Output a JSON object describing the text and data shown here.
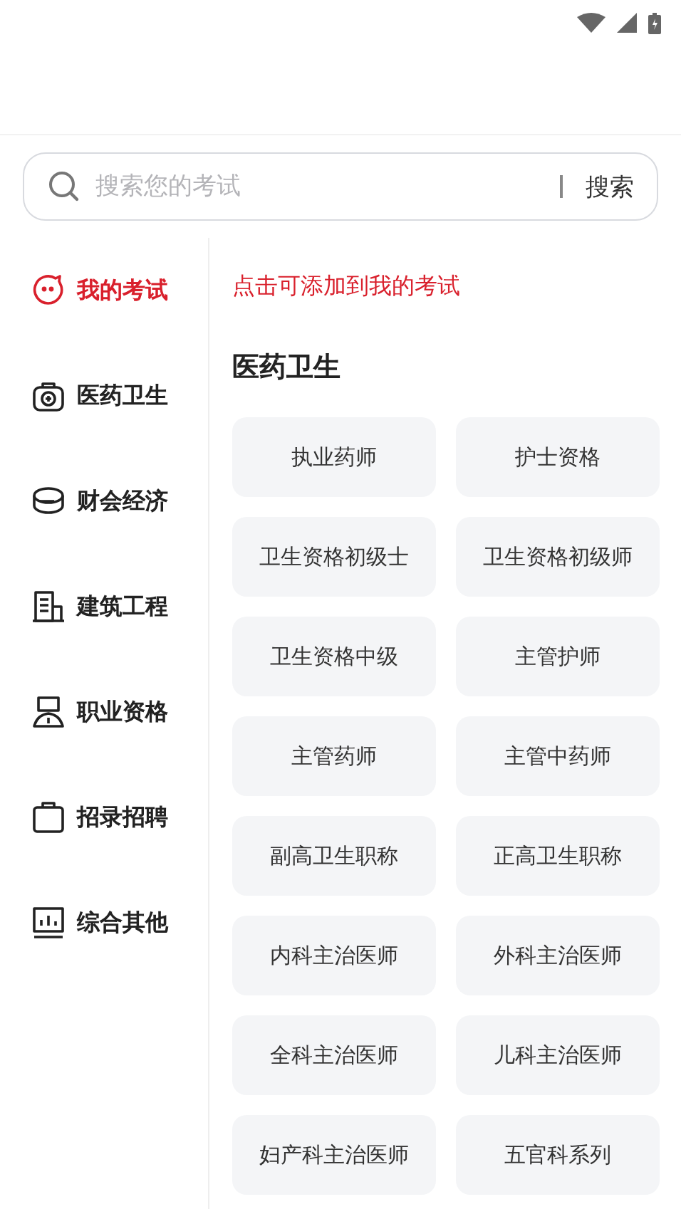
{
  "search": {
    "placeholder": "搜索您的考试",
    "button": "搜索"
  },
  "sidebar": {
    "items": [
      {
        "label": "我的考试",
        "selected": true
      },
      {
        "label": "医药卫生",
        "selected": false
      },
      {
        "label": "财会经济",
        "selected": false
      },
      {
        "label": "建筑工程",
        "selected": false
      },
      {
        "label": "职业资格",
        "selected": false
      },
      {
        "label": "招录招聘",
        "selected": false
      },
      {
        "label": "综合其他",
        "selected": false
      }
    ]
  },
  "hint": "点击可添加到我的考试",
  "section": {
    "title": "医药卫生",
    "exams": [
      "执业药师",
      "护士资格",
      "卫生资格初级士",
      "卫生资格初级师",
      "卫生资格中级",
      "主管护师",
      "主管药师",
      "主管中药师",
      "副高卫生职称",
      "正高卫生职称",
      "内科主治医师",
      "外科主治医师",
      "全科主治医师",
      "儿科主治医师",
      "妇产科主治医师",
      "五官科系列"
    ]
  }
}
